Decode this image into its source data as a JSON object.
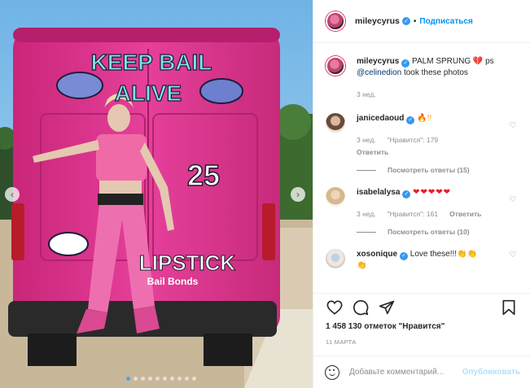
{
  "photo": {
    "van_text_top": "KEEP BAIL",
    "van_text_bottom": "ALIVE",
    "van_number": "25",
    "van_brand": "LIPSTICK",
    "van_brand_sub": "Bail Bonds",
    "carousel_total": 10,
    "carousel_active": 0
  },
  "header": {
    "username": "mileycyrus",
    "bullet": "•",
    "follow_label": "Подписаться"
  },
  "caption": {
    "username": "mileycyrus",
    "text_before": "PALM SPRUNG 💔 ps",
    "mention": "@celinedion",
    "text_after": "took these photos",
    "time": "3 нед."
  },
  "comments": [
    {
      "username": "janicedaoud",
      "text": "🔥!!",
      "time": "3 нед.",
      "likes": "\"Нравится\": 179",
      "reply": "Ответить",
      "view_replies": "Посмотреть ответы (15)"
    },
    {
      "username": "isabelalysa",
      "text": "❤❤❤❤❤",
      "time": "3 нед.",
      "likes": "\"Нравится\": 161",
      "reply": "Ответить",
      "view_replies": "Посмотреть ответы (10)"
    },
    {
      "username": "xosonique",
      "text": "Love these!!!👏👏",
      "text2": "👏"
    }
  ],
  "actions": {
    "likes_text": "1 458 130 отметок \"Нравится\"",
    "date": "11 МАРТА"
  },
  "add_comment": {
    "placeholder": "Добавьте комментарий...",
    "post_label": "Опубликовать"
  },
  "colors": {
    "accent": "#0095f6",
    "verified": "#3897f0",
    "van_pink": "#e2358f"
  }
}
